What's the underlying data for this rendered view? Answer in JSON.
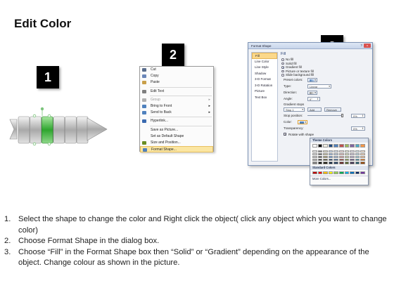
{
  "page": {
    "title": "Edit Color",
    "badges": [
      "1",
      "2",
      "3"
    ]
  },
  "shape": {
    "segment_count": 6,
    "selected_segment_index": 2,
    "segment_color": "#bfbfbf",
    "selected_color": "#33b233",
    "handle_color": "#7cc47c"
  },
  "context_menu": {
    "items": [
      {
        "label": "Cut",
        "icon": "scissors-icon",
        "disabled": false,
        "submenu": false,
        "separator_after": false
      },
      {
        "label": "Copy",
        "icon": "copy-icon",
        "disabled": false,
        "submenu": false,
        "separator_after": false
      },
      {
        "label": "Paste",
        "icon": "paste-icon",
        "disabled": false,
        "submenu": false,
        "separator_after": true
      },
      {
        "label": "Edit Text",
        "icon": "edit-text-icon",
        "disabled": false,
        "submenu": false,
        "separator_after": true
      },
      {
        "label": "Group",
        "icon": "group-icon",
        "disabled": true,
        "submenu": true,
        "separator_after": false
      },
      {
        "label": "Bring to Front",
        "icon": "bring-front-icon",
        "disabled": false,
        "submenu": true,
        "separator_after": false
      },
      {
        "label": "Send to Back",
        "icon": "send-back-icon",
        "disabled": false,
        "submenu": true,
        "separator_after": true
      },
      {
        "label": "Hyperlink...",
        "icon": "hyperlink-icon",
        "disabled": false,
        "submenu": false,
        "separator_after": true
      },
      {
        "label": "Save as Picture...",
        "icon": "",
        "disabled": false,
        "submenu": false,
        "separator_after": false
      },
      {
        "label": "Set as Default Shape",
        "icon": "",
        "disabled": false,
        "submenu": false,
        "separator_after": false
      },
      {
        "label": "Size and Position...",
        "icon": "size-icon",
        "disabled": false,
        "submenu": false,
        "separator_after": false
      },
      {
        "label": "Format Shape...",
        "icon": "format-shape-icon",
        "disabled": false,
        "submenu": false,
        "separator_after": false,
        "highlight": true
      }
    ]
  },
  "dialog": {
    "title": "Format Shape",
    "help": "?",
    "close": "x",
    "sidebar": [
      "Fill",
      "Line Color",
      "Line Style",
      "Shadow",
      "3-D Format",
      "3-D Rotation",
      "Picture",
      "Text Box"
    ],
    "active_sidebar_index": 0,
    "section_title": "Fill",
    "fill_options": [
      {
        "label": "No fill",
        "selected": false
      },
      {
        "label": "Solid fill",
        "selected": false
      },
      {
        "label": "Gradient fill",
        "selected": true
      },
      {
        "label": "Picture or texture fill",
        "selected": false
      },
      {
        "label": "Slide background fill",
        "selected": false
      }
    ],
    "fields": {
      "preset_colors": "Preset colors:",
      "type_label": "Type:",
      "type_value": "Linear",
      "direction_label": "Direction:",
      "angle_label": "Angle:",
      "angle_value": "0°",
      "gradient_stops": "Gradient stops",
      "stop_value": "Stop 1",
      "add": "Add",
      "remove": "Remove",
      "stop_position_label": "Stop position:",
      "stop_position_value": "0%",
      "color_label": "Color:",
      "transparency_label": "Transparency:",
      "transparency_value": "0%",
      "rotate_label": "Rotate with shape"
    }
  },
  "palette": {
    "theme_title": "Theme Colors",
    "standard_title": "Standard Colors",
    "more_colors": "More Colors...",
    "theme_top": [
      "#ffffff",
      "#000000",
      "#eeece1",
      "#1f497d",
      "#4f81bd",
      "#c0504d",
      "#9bbb59",
      "#8064a2",
      "#4bacc6",
      "#f79646"
    ],
    "theme_shades": [
      [
        "#f2f2f2",
        "#7f7f7f",
        "#ddd9c3",
        "#c6d9f0",
        "#dbe5f1",
        "#f2dcdb",
        "#ebf1dd",
        "#e5e0ec",
        "#dbeef3",
        "#fdeada"
      ],
      [
        "#d8d8d8",
        "#595959",
        "#c4bd97",
        "#8db3e2",
        "#b8cce4",
        "#e5b9b7",
        "#d7e3bc",
        "#ccc1d9",
        "#b7dde8",
        "#fbd5b5"
      ],
      [
        "#bfbfbf",
        "#3f3f3f",
        "#938953",
        "#548dd4",
        "#95b3d7",
        "#d99694",
        "#c3d69b",
        "#b2a2c7",
        "#92cddc",
        "#fac08f"
      ],
      [
        "#a5a5a5",
        "#262626",
        "#494429",
        "#17365d",
        "#366092",
        "#953734",
        "#76923c",
        "#5f497a",
        "#31859b",
        "#e36c09"
      ],
      [
        "#7f7f7f",
        "#0c0c0c",
        "#1d1b10",
        "#0f243e",
        "#244061",
        "#632423",
        "#4f6128",
        "#3f3151",
        "#205867",
        "#974806"
      ]
    ],
    "standard": [
      "#c00000",
      "#ff0000",
      "#ffc000",
      "#ffff00",
      "#92d050",
      "#00b050",
      "#00b0f0",
      "#0070c0",
      "#002060",
      "#7030a0"
    ]
  },
  "instructions": [
    {
      "num": "1.",
      "text": "Select the shape to change the color and Right click the object( click any object which you want to change color)"
    },
    {
      "num": "2.",
      "text": "Choose Format Shape in the dialog box."
    },
    {
      "num": "3.",
      "text": "Choose “Fill” in the Format Shape box then “Solid” or “Gradient” depending on the appearance of the object. Change colour as shown in the picture."
    }
  ]
}
